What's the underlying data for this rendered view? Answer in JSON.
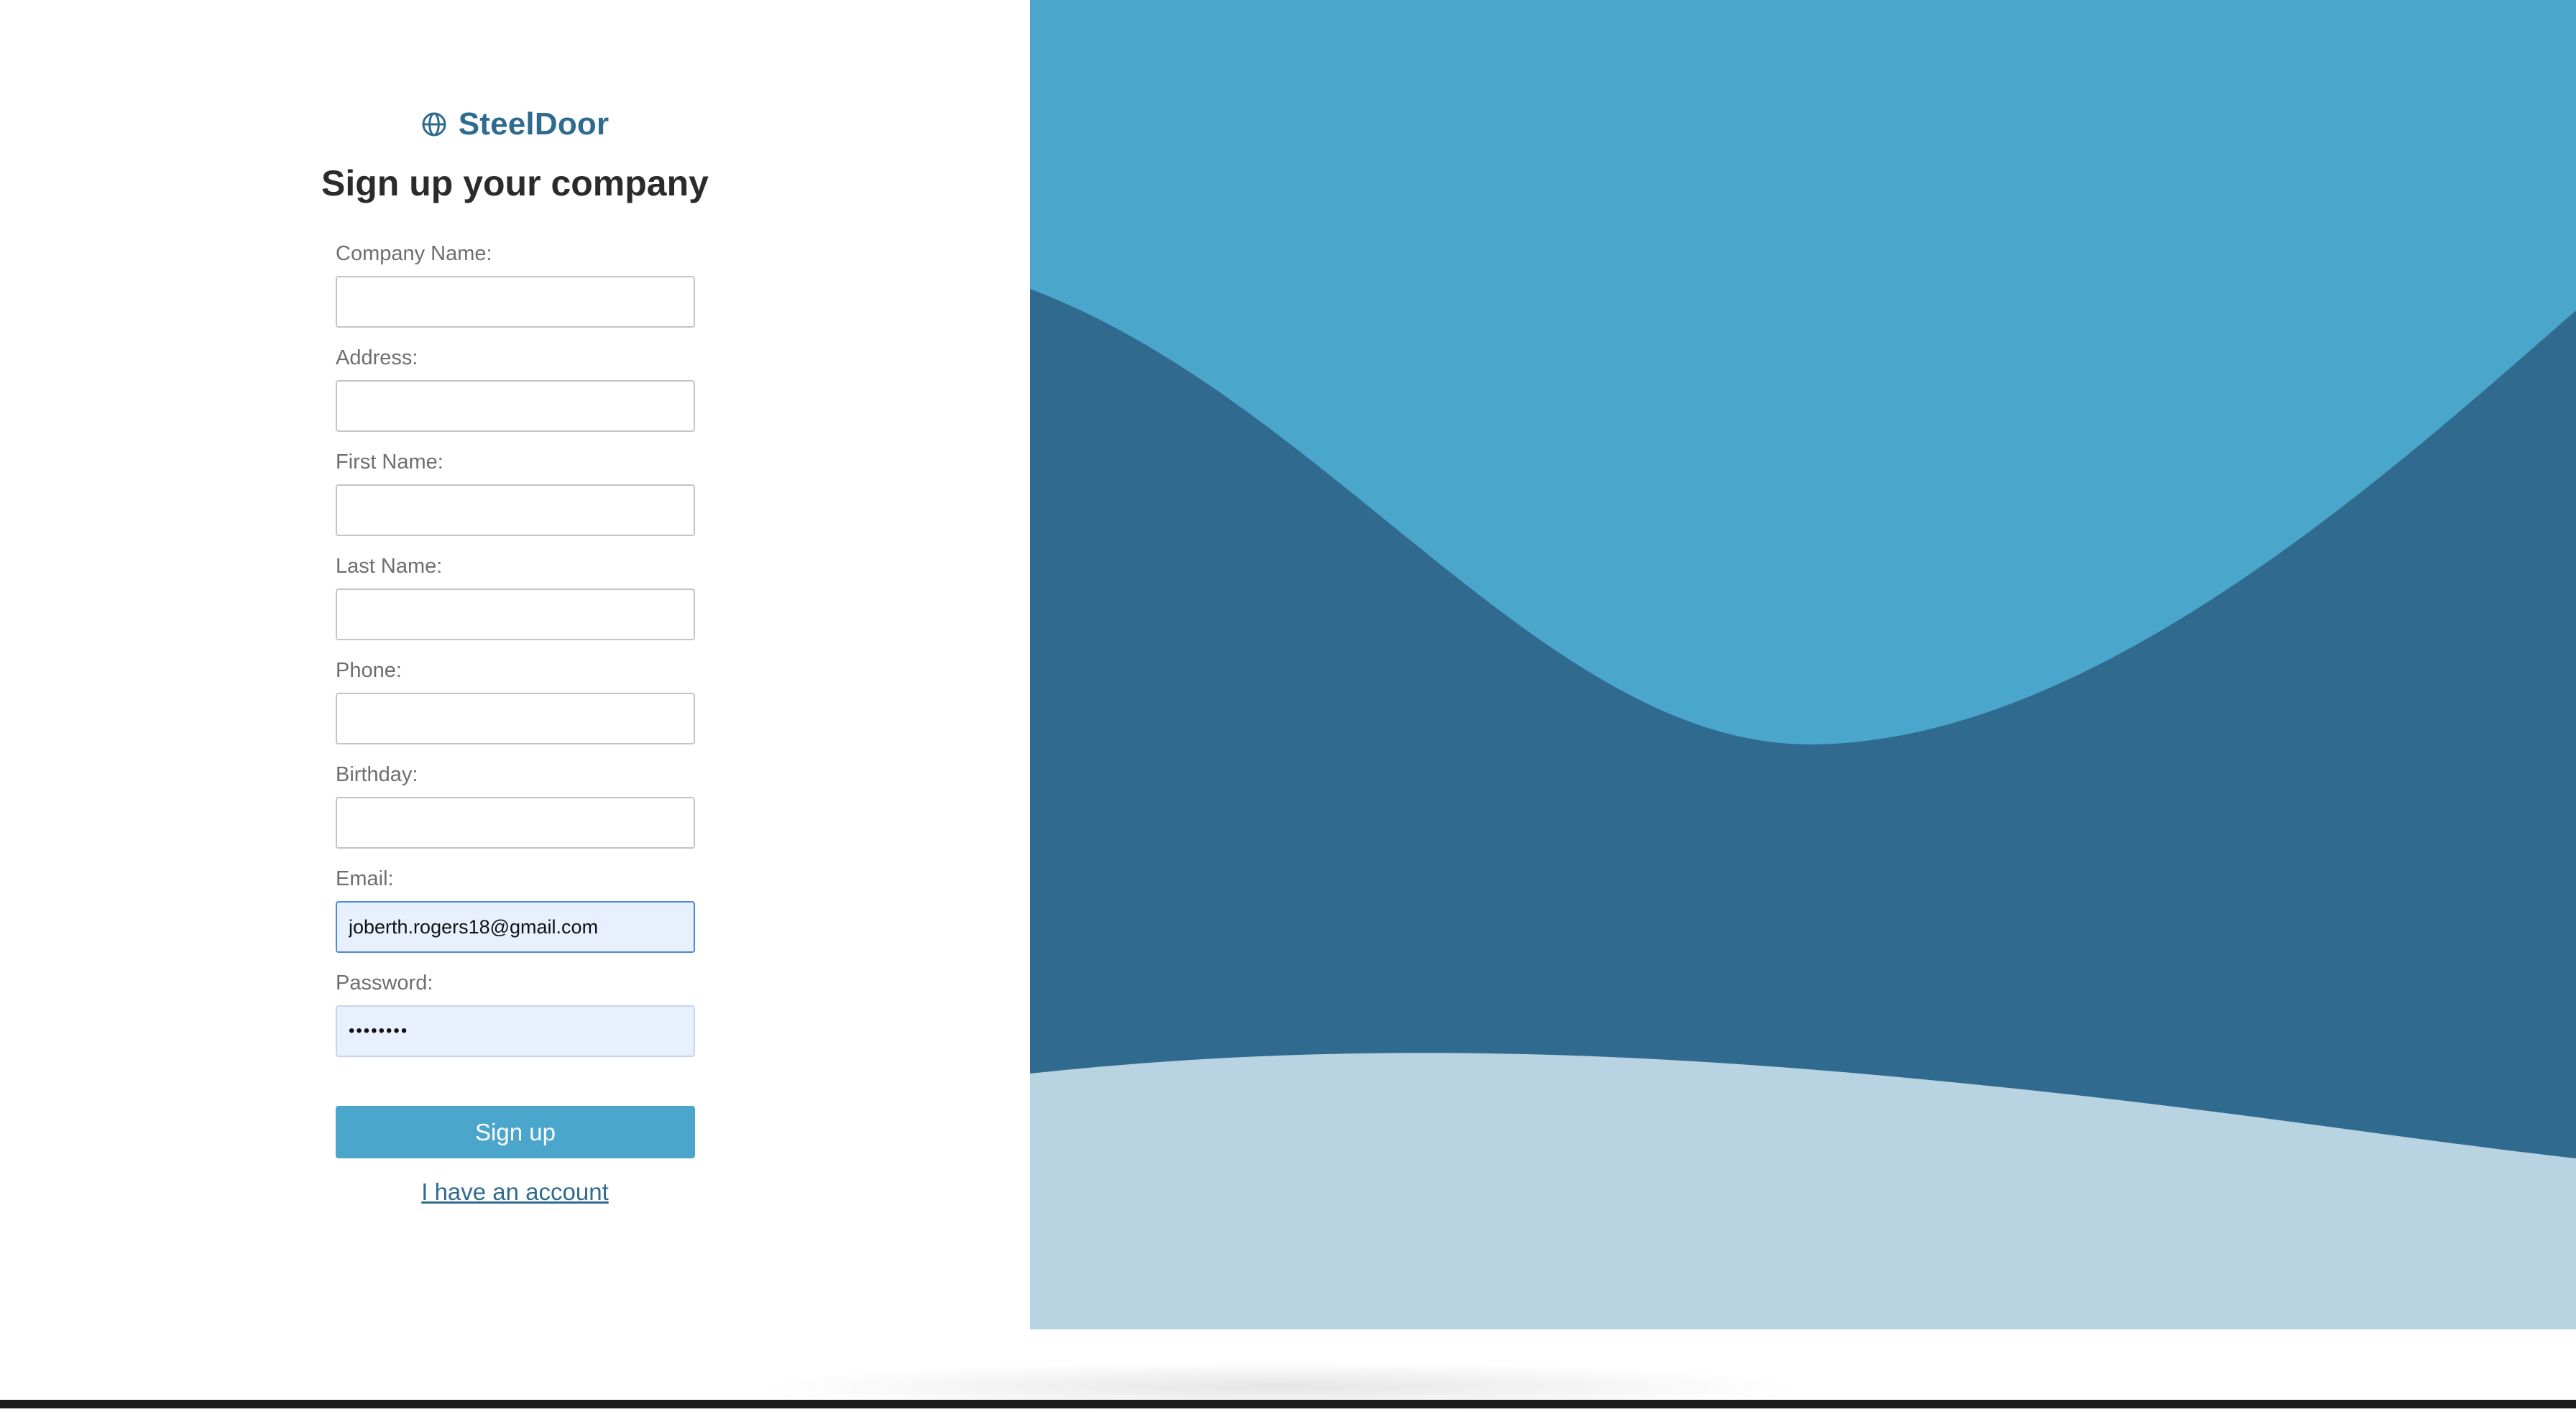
{
  "brand": {
    "name": "SteelDoor",
    "icon": "globe-icon"
  },
  "page": {
    "title": "Sign up your company"
  },
  "form": {
    "company_name": {
      "label": "Company Name:",
      "value": ""
    },
    "address": {
      "label": "Address:",
      "value": ""
    },
    "first_name": {
      "label": "First Name:",
      "value": ""
    },
    "last_name": {
      "label": "Last Name:",
      "value": ""
    },
    "phone": {
      "label": "Phone:",
      "value": ""
    },
    "birthday": {
      "label": "Birthday:",
      "value": ""
    },
    "email": {
      "label": "Email:",
      "value": "joberth.rogers18@gmail.com"
    },
    "password": {
      "label": "Password:",
      "value": "••••••••"
    },
    "submit_label": "Sign up",
    "login_link": "I have an account"
  },
  "colors": {
    "brand": "#2f6b8f",
    "button": "#4ba6cb",
    "art_top": "#4ba6cb",
    "art_middle": "#306b8f",
    "art_bottom": "#b8d3e1"
  }
}
